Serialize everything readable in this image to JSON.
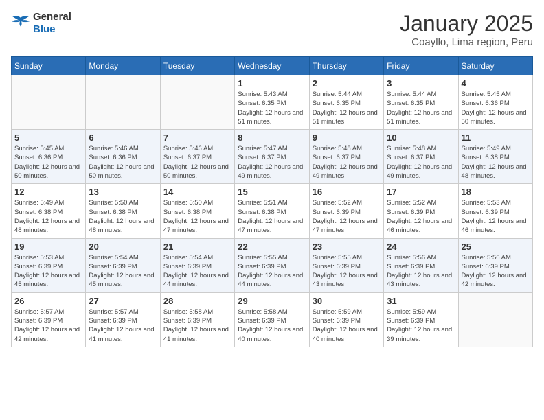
{
  "header": {
    "logo_general": "General",
    "logo_blue": "Blue",
    "month": "January 2025",
    "location": "Coayllo, Lima region, Peru"
  },
  "weekdays": [
    "Sunday",
    "Monday",
    "Tuesday",
    "Wednesday",
    "Thursday",
    "Friday",
    "Saturday"
  ],
  "weeks": [
    [
      {
        "day": "",
        "sunrise": "",
        "sunset": "",
        "daylight": ""
      },
      {
        "day": "",
        "sunrise": "",
        "sunset": "",
        "daylight": ""
      },
      {
        "day": "",
        "sunrise": "",
        "sunset": "",
        "daylight": ""
      },
      {
        "day": "1",
        "sunrise": "Sunrise: 5:43 AM",
        "sunset": "Sunset: 6:35 PM",
        "daylight": "Daylight: 12 hours and 51 minutes."
      },
      {
        "day": "2",
        "sunrise": "Sunrise: 5:44 AM",
        "sunset": "Sunset: 6:35 PM",
        "daylight": "Daylight: 12 hours and 51 minutes."
      },
      {
        "day": "3",
        "sunrise": "Sunrise: 5:44 AM",
        "sunset": "Sunset: 6:35 PM",
        "daylight": "Daylight: 12 hours and 51 minutes."
      },
      {
        "day": "4",
        "sunrise": "Sunrise: 5:45 AM",
        "sunset": "Sunset: 6:36 PM",
        "daylight": "Daylight: 12 hours and 50 minutes."
      }
    ],
    [
      {
        "day": "5",
        "sunrise": "Sunrise: 5:45 AM",
        "sunset": "Sunset: 6:36 PM",
        "daylight": "Daylight: 12 hours and 50 minutes."
      },
      {
        "day": "6",
        "sunrise": "Sunrise: 5:46 AM",
        "sunset": "Sunset: 6:36 PM",
        "daylight": "Daylight: 12 hours and 50 minutes."
      },
      {
        "day": "7",
        "sunrise": "Sunrise: 5:46 AM",
        "sunset": "Sunset: 6:37 PM",
        "daylight": "Daylight: 12 hours and 50 minutes."
      },
      {
        "day": "8",
        "sunrise": "Sunrise: 5:47 AM",
        "sunset": "Sunset: 6:37 PM",
        "daylight": "Daylight: 12 hours and 49 minutes."
      },
      {
        "day": "9",
        "sunrise": "Sunrise: 5:48 AM",
        "sunset": "Sunset: 6:37 PM",
        "daylight": "Daylight: 12 hours and 49 minutes."
      },
      {
        "day": "10",
        "sunrise": "Sunrise: 5:48 AM",
        "sunset": "Sunset: 6:37 PM",
        "daylight": "Daylight: 12 hours and 49 minutes."
      },
      {
        "day": "11",
        "sunrise": "Sunrise: 5:49 AM",
        "sunset": "Sunset: 6:38 PM",
        "daylight": "Daylight: 12 hours and 48 minutes."
      }
    ],
    [
      {
        "day": "12",
        "sunrise": "Sunrise: 5:49 AM",
        "sunset": "Sunset: 6:38 PM",
        "daylight": "Daylight: 12 hours and 48 minutes."
      },
      {
        "day": "13",
        "sunrise": "Sunrise: 5:50 AM",
        "sunset": "Sunset: 6:38 PM",
        "daylight": "Daylight: 12 hours and 48 minutes."
      },
      {
        "day": "14",
        "sunrise": "Sunrise: 5:50 AM",
        "sunset": "Sunset: 6:38 PM",
        "daylight": "Daylight: 12 hours and 47 minutes."
      },
      {
        "day": "15",
        "sunrise": "Sunrise: 5:51 AM",
        "sunset": "Sunset: 6:38 PM",
        "daylight": "Daylight: 12 hours and 47 minutes."
      },
      {
        "day": "16",
        "sunrise": "Sunrise: 5:52 AM",
        "sunset": "Sunset: 6:39 PM",
        "daylight": "Daylight: 12 hours and 47 minutes."
      },
      {
        "day": "17",
        "sunrise": "Sunrise: 5:52 AM",
        "sunset": "Sunset: 6:39 PM",
        "daylight": "Daylight: 12 hours and 46 minutes."
      },
      {
        "day": "18",
        "sunrise": "Sunrise: 5:53 AM",
        "sunset": "Sunset: 6:39 PM",
        "daylight": "Daylight: 12 hours and 46 minutes."
      }
    ],
    [
      {
        "day": "19",
        "sunrise": "Sunrise: 5:53 AM",
        "sunset": "Sunset: 6:39 PM",
        "daylight": "Daylight: 12 hours and 45 minutes."
      },
      {
        "day": "20",
        "sunrise": "Sunrise: 5:54 AM",
        "sunset": "Sunset: 6:39 PM",
        "daylight": "Daylight: 12 hours and 45 minutes."
      },
      {
        "day": "21",
        "sunrise": "Sunrise: 5:54 AM",
        "sunset": "Sunset: 6:39 PM",
        "daylight": "Daylight: 12 hours and 44 minutes."
      },
      {
        "day": "22",
        "sunrise": "Sunrise: 5:55 AM",
        "sunset": "Sunset: 6:39 PM",
        "daylight": "Daylight: 12 hours and 44 minutes."
      },
      {
        "day": "23",
        "sunrise": "Sunrise: 5:55 AM",
        "sunset": "Sunset: 6:39 PM",
        "daylight": "Daylight: 12 hours and 43 minutes."
      },
      {
        "day": "24",
        "sunrise": "Sunrise: 5:56 AM",
        "sunset": "Sunset: 6:39 PM",
        "daylight": "Daylight: 12 hours and 43 minutes."
      },
      {
        "day": "25",
        "sunrise": "Sunrise: 5:56 AM",
        "sunset": "Sunset: 6:39 PM",
        "daylight": "Daylight: 12 hours and 42 minutes."
      }
    ],
    [
      {
        "day": "26",
        "sunrise": "Sunrise: 5:57 AM",
        "sunset": "Sunset: 6:39 PM",
        "daylight": "Daylight: 12 hours and 42 minutes."
      },
      {
        "day": "27",
        "sunrise": "Sunrise: 5:57 AM",
        "sunset": "Sunset: 6:39 PM",
        "daylight": "Daylight: 12 hours and 41 minutes."
      },
      {
        "day": "28",
        "sunrise": "Sunrise: 5:58 AM",
        "sunset": "Sunset: 6:39 PM",
        "daylight": "Daylight: 12 hours and 41 minutes."
      },
      {
        "day": "29",
        "sunrise": "Sunrise: 5:58 AM",
        "sunset": "Sunset: 6:39 PM",
        "daylight": "Daylight: 12 hours and 40 minutes."
      },
      {
        "day": "30",
        "sunrise": "Sunrise: 5:59 AM",
        "sunset": "Sunset: 6:39 PM",
        "daylight": "Daylight: 12 hours and 40 minutes."
      },
      {
        "day": "31",
        "sunrise": "Sunrise: 5:59 AM",
        "sunset": "Sunset: 6:39 PM",
        "daylight": "Daylight: 12 hours and 39 minutes."
      },
      {
        "day": "",
        "sunrise": "",
        "sunset": "",
        "daylight": ""
      }
    ]
  ]
}
